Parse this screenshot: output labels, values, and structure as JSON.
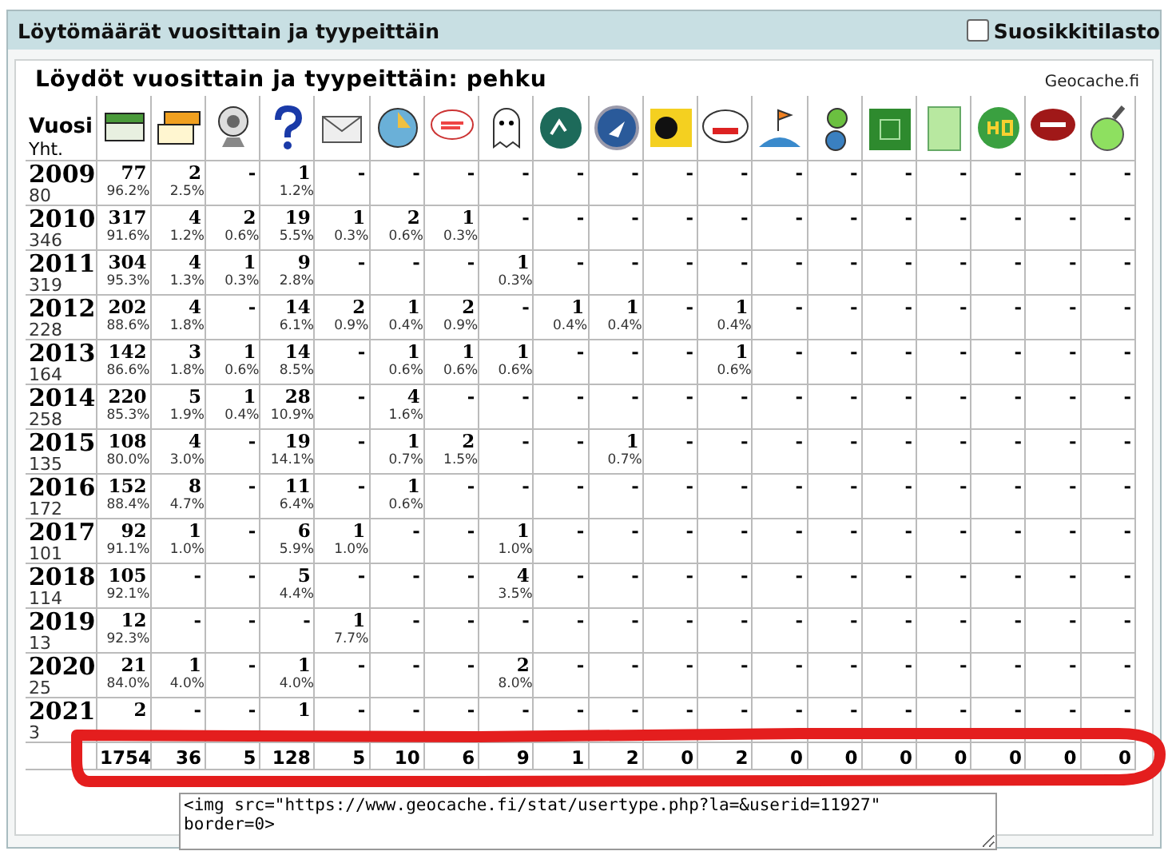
{
  "panel": {
    "title": "Löytömäärät vuosittain ja tyypeittäin",
    "favorites_toggle": {
      "label": "Suosikkitilasto",
      "checked": false
    }
  },
  "report": {
    "title": "Löydöt vuosittain ja tyypeittäin: pehku",
    "source": "Geocache.fi",
    "year_header": "Vuosi",
    "total_header": "Yht.",
    "rows": [
      {
        "year": "2009",
        "total": "80",
        "cells": [
          [
            "77",
            "96.2%"
          ],
          [
            "2",
            "2.5%"
          ],
          [
            "-"
          ],
          [
            "1",
            "1.2%"
          ],
          [
            "-"
          ],
          [
            "-"
          ],
          [
            "-"
          ],
          [
            "-"
          ],
          [
            "-"
          ],
          [
            "-"
          ],
          [
            "-"
          ],
          [
            "-"
          ],
          [
            "-"
          ],
          [
            "-"
          ],
          [
            "-"
          ],
          [
            "-"
          ],
          [
            "-"
          ],
          [
            "-"
          ],
          [
            "-"
          ]
        ]
      },
      {
        "year": "2010",
        "total": "346",
        "cells": [
          [
            "317",
            "91.6%"
          ],
          [
            "4",
            "1.2%"
          ],
          [
            "2",
            "0.6%"
          ],
          [
            "19",
            "5.5%"
          ],
          [
            "1",
            "0.3%"
          ],
          [
            "2",
            "0.6%"
          ],
          [
            "1",
            "0.3%"
          ],
          [
            "-"
          ],
          [
            "-"
          ],
          [
            "-"
          ],
          [
            "-"
          ],
          [
            "-"
          ],
          [
            "-"
          ],
          [
            "-"
          ],
          [
            "-"
          ],
          [
            "-"
          ],
          [
            "-"
          ],
          [
            "-"
          ],
          [
            "-"
          ]
        ]
      },
      {
        "year": "2011",
        "total": "319",
        "cells": [
          [
            "304",
            "95.3%"
          ],
          [
            "4",
            "1.3%"
          ],
          [
            "1",
            "0.3%"
          ],
          [
            "9",
            "2.8%"
          ],
          [
            "-"
          ],
          [
            "-"
          ],
          [
            "-"
          ],
          [
            "1",
            "0.3%"
          ],
          [
            "-"
          ],
          [
            "-"
          ],
          [
            "-"
          ],
          [
            "-"
          ],
          [
            "-"
          ],
          [
            "-"
          ],
          [
            "-"
          ],
          [
            "-"
          ],
          [
            "-"
          ],
          [
            "-"
          ],
          [
            "-"
          ]
        ]
      },
      {
        "year": "2012",
        "total": "228",
        "cells": [
          [
            "202",
            "88.6%"
          ],
          [
            "4",
            "1.8%"
          ],
          [
            "-"
          ],
          [
            "14",
            "6.1%"
          ],
          [
            "2",
            "0.9%"
          ],
          [
            "1",
            "0.4%"
          ],
          [
            "2",
            "0.9%"
          ],
          [
            "-"
          ],
          [
            "1",
            "0.4%"
          ],
          [
            "1",
            "0.4%"
          ],
          [
            "-"
          ],
          [
            "1",
            "0.4%"
          ],
          [
            "-"
          ],
          [
            "-"
          ],
          [
            "-"
          ],
          [
            "-"
          ],
          [
            "-"
          ],
          [
            "-"
          ],
          [
            "-"
          ]
        ]
      },
      {
        "year": "2013",
        "total": "164",
        "cells": [
          [
            "142",
            "86.6%"
          ],
          [
            "3",
            "1.8%"
          ],
          [
            "1",
            "0.6%"
          ],
          [
            "14",
            "8.5%"
          ],
          [
            "-"
          ],
          [
            "1",
            "0.6%"
          ],
          [
            "1",
            "0.6%"
          ],
          [
            "1",
            "0.6%"
          ],
          [
            "-"
          ],
          [
            "-"
          ],
          [
            "-"
          ],
          [
            "1",
            "0.6%"
          ],
          [
            "-"
          ],
          [
            "-"
          ],
          [
            "-"
          ],
          [
            "-"
          ],
          [
            "-"
          ],
          [
            "-"
          ],
          [
            "-"
          ]
        ]
      },
      {
        "year": "2014",
        "total": "258",
        "cells": [
          [
            "220",
            "85.3%"
          ],
          [
            "5",
            "1.9%"
          ],
          [
            "1",
            "0.4%"
          ],
          [
            "28",
            "10.9%"
          ],
          [
            "-"
          ],
          [
            "4",
            "1.6%"
          ],
          [
            "-"
          ],
          [
            "-"
          ],
          [
            "-"
          ],
          [
            "-"
          ],
          [
            "-"
          ],
          [
            "-"
          ],
          [
            "-"
          ],
          [
            "-"
          ],
          [
            "-"
          ],
          [
            "-"
          ],
          [
            "-"
          ],
          [
            "-"
          ],
          [
            "-"
          ]
        ]
      },
      {
        "year": "2015",
        "total": "135",
        "cells": [
          [
            "108",
            "80.0%"
          ],
          [
            "4",
            "3.0%"
          ],
          [
            "-"
          ],
          [
            "19",
            "14.1%"
          ],
          [
            "-"
          ],
          [
            "1",
            "0.7%"
          ],
          [
            "2",
            "1.5%"
          ],
          [
            "-"
          ],
          [
            "-"
          ],
          [
            "1",
            "0.7%"
          ],
          [
            "-"
          ],
          [
            "-"
          ],
          [
            "-"
          ],
          [
            "-"
          ],
          [
            "-"
          ],
          [
            "-"
          ],
          [
            "-"
          ],
          [
            "-"
          ],
          [
            "-"
          ]
        ]
      },
      {
        "year": "2016",
        "total": "172",
        "cells": [
          [
            "152",
            "88.4%"
          ],
          [
            "8",
            "4.7%"
          ],
          [
            "-"
          ],
          [
            "11",
            "6.4%"
          ],
          [
            "-"
          ],
          [
            "1",
            "0.6%"
          ],
          [
            "-"
          ],
          [
            "-"
          ],
          [
            "-"
          ],
          [
            "-"
          ],
          [
            "-"
          ],
          [
            "-"
          ],
          [
            "-"
          ],
          [
            "-"
          ],
          [
            "-"
          ],
          [
            "-"
          ],
          [
            "-"
          ],
          [
            "-"
          ],
          [
            "-"
          ]
        ]
      },
      {
        "year": "2017",
        "total": "101",
        "cells": [
          [
            "92",
            "91.1%"
          ],
          [
            "1",
            "1.0%"
          ],
          [
            "-"
          ],
          [
            "6",
            "5.9%"
          ],
          [
            "1",
            "1.0%"
          ],
          [
            "-"
          ],
          [
            "-"
          ],
          [
            "1",
            "1.0%"
          ],
          [
            "-"
          ],
          [
            "-"
          ],
          [
            "-"
          ],
          [
            "-"
          ],
          [
            "-"
          ],
          [
            "-"
          ],
          [
            "-"
          ],
          [
            "-"
          ],
          [
            "-"
          ],
          [
            "-"
          ],
          [
            "-"
          ]
        ]
      },
      {
        "year": "2018",
        "total": "114",
        "cells": [
          [
            "105",
            "92.1%"
          ],
          [
            "-"
          ],
          [
            "-"
          ],
          [
            "5",
            "4.4%"
          ],
          [
            "-"
          ],
          [
            "-"
          ],
          [
            "-"
          ],
          [
            "4",
            "3.5%"
          ],
          [
            "-"
          ],
          [
            "-"
          ],
          [
            "-"
          ],
          [
            "-"
          ],
          [
            "-"
          ],
          [
            "-"
          ],
          [
            "-"
          ],
          [
            "-"
          ],
          [
            "-"
          ],
          [
            "-"
          ],
          [
            "-"
          ]
        ]
      },
      {
        "year": "2019",
        "total": "13",
        "cells": [
          [
            "12",
            "92.3%"
          ],
          [
            "-"
          ],
          [
            "-"
          ],
          [
            "-"
          ],
          [
            "1",
            "7.7%"
          ],
          [
            "-"
          ],
          [
            "-"
          ],
          [
            "-"
          ],
          [
            "-"
          ],
          [
            "-"
          ],
          [
            "-"
          ],
          [
            "-"
          ],
          [
            "-"
          ],
          [
            "-"
          ],
          [
            "-"
          ],
          [
            "-"
          ],
          [
            "-"
          ],
          [
            "-"
          ],
          [
            "-"
          ]
        ]
      },
      {
        "year": "2020",
        "total": "25",
        "cells": [
          [
            "21",
            "84.0%"
          ],
          [
            "1",
            "4.0%"
          ],
          [
            "-"
          ],
          [
            "1",
            "4.0%"
          ],
          [
            "-"
          ],
          [
            "-"
          ],
          [
            "-"
          ],
          [
            "2",
            "8.0%"
          ],
          [
            "-"
          ],
          [
            "-"
          ],
          [
            "-"
          ],
          [
            "-"
          ],
          [
            "-"
          ],
          [
            "-"
          ],
          [
            "-"
          ],
          [
            "-"
          ],
          [
            "-"
          ],
          [
            "-"
          ],
          [
            "-"
          ]
        ]
      },
      {
        "year": "2021",
        "total": "3",
        "cells": [
          [
            "2"
          ],
          [
            "-"
          ],
          [
            "-"
          ],
          [
            "1"
          ],
          [
            "-"
          ],
          [
            "-"
          ],
          [
            "-"
          ],
          [
            "-"
          ],
          [
            "-"
          ],
          [
            "-"
          ],
          [
            "-"
          ],
          [
            "-"
          ],
          [
            "-"
          ],
          [
            "-"
          ],
          [
            "-"
          ],
          [
            "-"
          ],
          [
            "-"
          ],
          [
            "-"
          ],
          [
            "-"
          ]
        ]
      }
    ],
    "totals": [
      "1754",
      "36",
      "5",
      "128",
      "5",
      "10",
      "6",
      "9",
      "1",
      "2",
      "0",
      "2",
      "0",
      "0",
      "0",
      "0",
      "0",
      "0",
      "0"
    ],
    "embed_code": "<img src=\"https://www.geocache.fi/stat/usertype.php?la=&userid=11927\"\nborder=0>"
  }
}
